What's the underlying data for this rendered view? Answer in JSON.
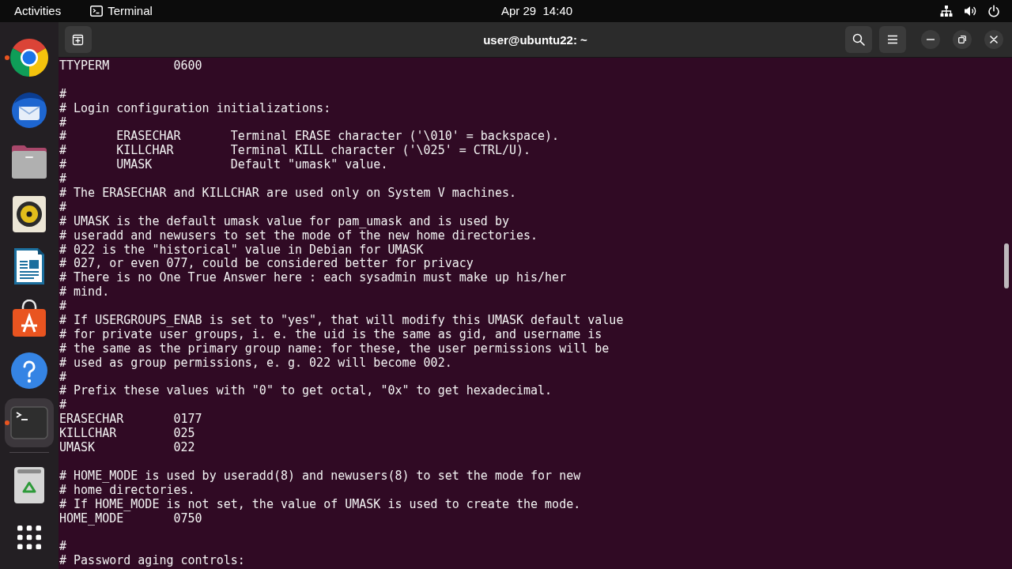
{
  "top_bar": {
    "activities": "Activities",
    "app_menu": "Terminal",
    "clock": "Apr 29  14:40"
  },
  "dock": {
    "items": [
      {
        "kind": "browser",
        "running": true,
        "selected": false
      },
      {
        "kind": "mail",
        "running": false,
        "selected": false
      },
      {
        "kind": "files",
        "running": false,
        "selected": false
      },
      {
        "kind": "music",
        "running": false,
        "selected": false
      },
      {
        "kind": "writer",
        "running": false,
        "selected": false
      },
      {
        "kind": "store",
        "running": false,
        "selected": false
      },
      {
        "kind": "help",
        "running": false,
        "selected": false
      },
      {
        "kind": "terminal",
        "running": true,
        "selected": true
      },
      {
        "kind": "trash",
        "running": false,
        "selected": false
      },
      {
        "kind": "apps",
        "running": false,
        "selected": false
      }
    ]
  },
  "terminal": {
    "title": "user@ubuntu22: ~",
    "blocks": [
      [
        "TTYPERM         0600"
      ],
      [
        "#",
        "# Login configuration initializations:",
        "#",
        "#       ERASECHAR       Terminal ERASE character ('\\010' = backspace).",
        "#       KILLCHAR        Terminal KILL character ('\\025' = CTRL/U).",
        "#       UMASK           Default \"umask\" value.",
        "#",
        "# The ERASECHAR and KILLCHAR are used only on System V machines.",
        "#",
        "# UMASK is the default umask value for pam_umask and is used by",
        "# useradd and newusers to set the mode of the new home directories.",
        "# 022 is the \"historical\" value in Debian for UMASK",
        "# 027, or even 077, could be considered better for privacy",
        "# There is no One True Answer here : each sysadmin must make up his/her",
        "# mind.",
        "#",
        "# If USERGROUPS_ENAB is set to \"yes\", that will modify this UMASK default value",
        "# for private user groups, i. e. the uid is the same as gid, and username is",
        "# the same as the primary group name: for these, the user permissions will be",
        "# used as group permissions, e. g. 022 will become 002.",
        "#",
        "# Prefix these values with \"0\" to get octal, \"0x\" to get hexadecimal.",
        "#",
        "ERASECHAR       0177",
        "KILLCHAR        025",
        "UMASK           022"
      ],
      [
        "# HOME_MODE is used by useradd(8) and newusers(8) to set the mode for new",
        "# home directories.",
        "# If HOME_MODE is not set, the value of UMASK is used to create the mode.",
        "HOME_MODE       0750"
      ],
      [
        "#",
        "# Password aging controls:"
      ]
    ]
  }
}
